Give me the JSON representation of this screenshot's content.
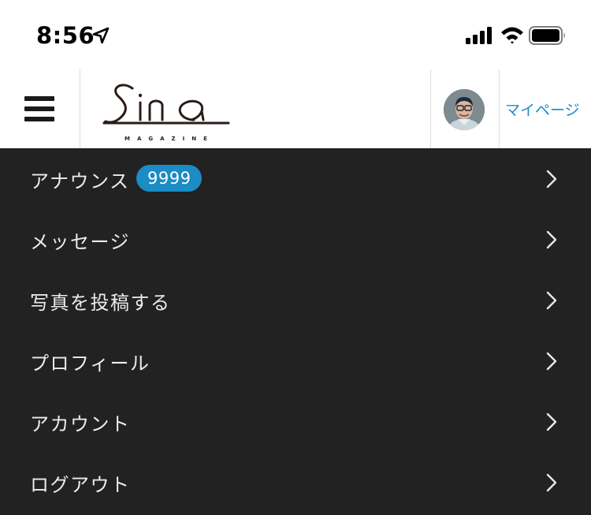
{
  "status_bar": {
    "time": "8:56",
    "icons": [
      "location-arrow-icon",
      "cellular-signal-icon",
      "wifi-icon",
      "battery-icon"
    ]
  },
  "header": {
    "logo_text": "Sina",
    "logo_subtitle": "MAGAZINE",
    "mypage_label": "マイページ",
    "accent_color": "#1b8cc4"
  },
  "menu": {
    "background_color": "#222222",
    "items": [
      {
        "label": "アナウンス",
        "badge": "9999"
      },
      {
        "label": "メッセージ"
      },
      {
        "label": "写真を投稿する"
      },
      {
        "label": "プロフィール"
      },
      {
        "label": "アカウント"
      },
      {
        "label": "ログアウト"
      }
    ]
  }
}
